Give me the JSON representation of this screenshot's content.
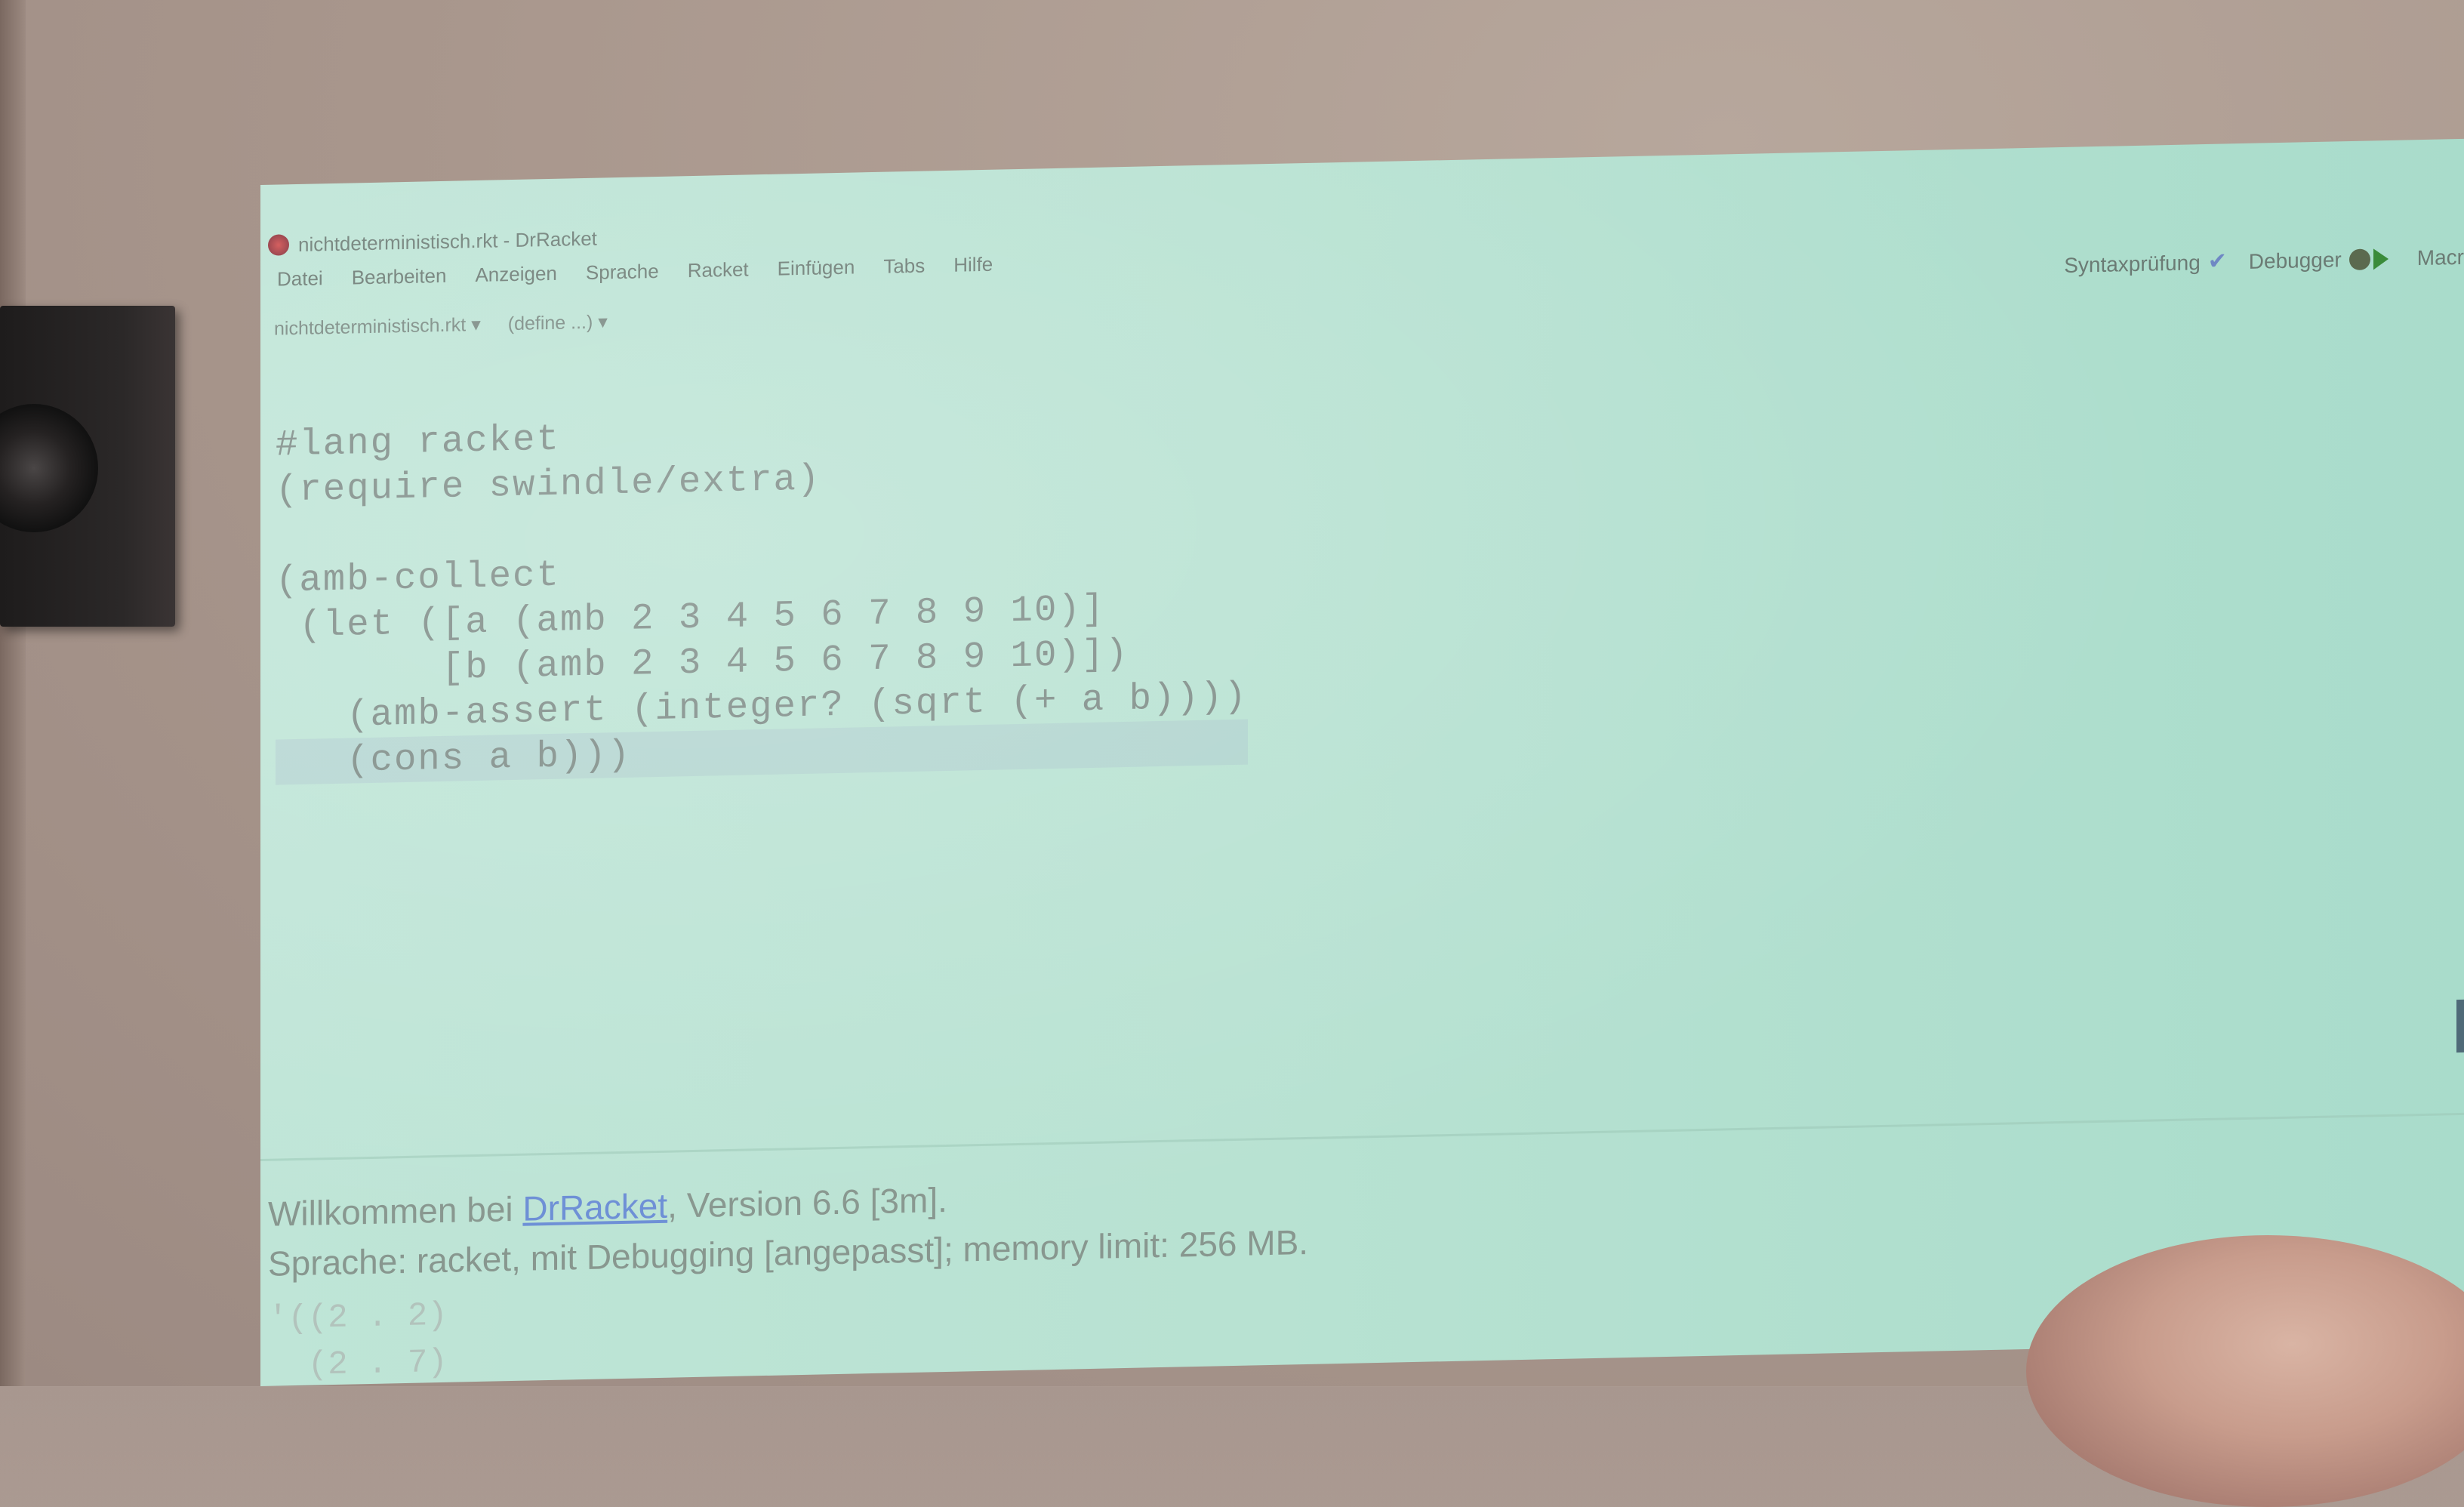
{
  "window": {
    "title": "nichtdeterministisch.rkt - DrRacket"
  },
  "menubar": [
    "Datei",
    "Bearbeiten",
    "Anzeigen",
    "Sprache",
    "Racket",
    "Einfügen",
    "Tabs",
    "Hilfe"
  ],
  "toolbar": {
    "file_dropdown": "nichtdeterministisch.rkt ▾",
    "define_dropdown": "(define ...) ▾",
    "syntax_check_label": "Syntaxprüfung",
    "debugger_label": "Debugger",
    "macro_label": "Macr"
  },
  "editor": {
    "lines": [
      "#lang racket",
      "(require swindle/extra)",
      "",
      "(amb-collect",
      " (let ([a (amb 2 3 4 5 6 7 8 9 10)]",
      "       [b (amb 2 3 4 5 6 7 8 9 10)])",
      "   (amb-assert (integer? (sqrt (+ a b))))",
      "   (cons a b)))"
    ]
  },
  "repl": {
    "welcome_prefix": "Willkommen bei ",
    "welcome_link": "DrRacket",
    "welcome_suffix": ", Version 6.6 [3m].",
    "language_line": "Sprache: racket, mit Debugging [angepasst]; memory limit: 256 MB.",
    "output_lines": [
      "'((2 . 2)",
      "  (2 . 7)"
    ]
  },
  "colors": {
    "screen_bg": "#bfe5d7",
    "text": "#7f8d88",
    "link": "#6d8fd6"
  }
}
